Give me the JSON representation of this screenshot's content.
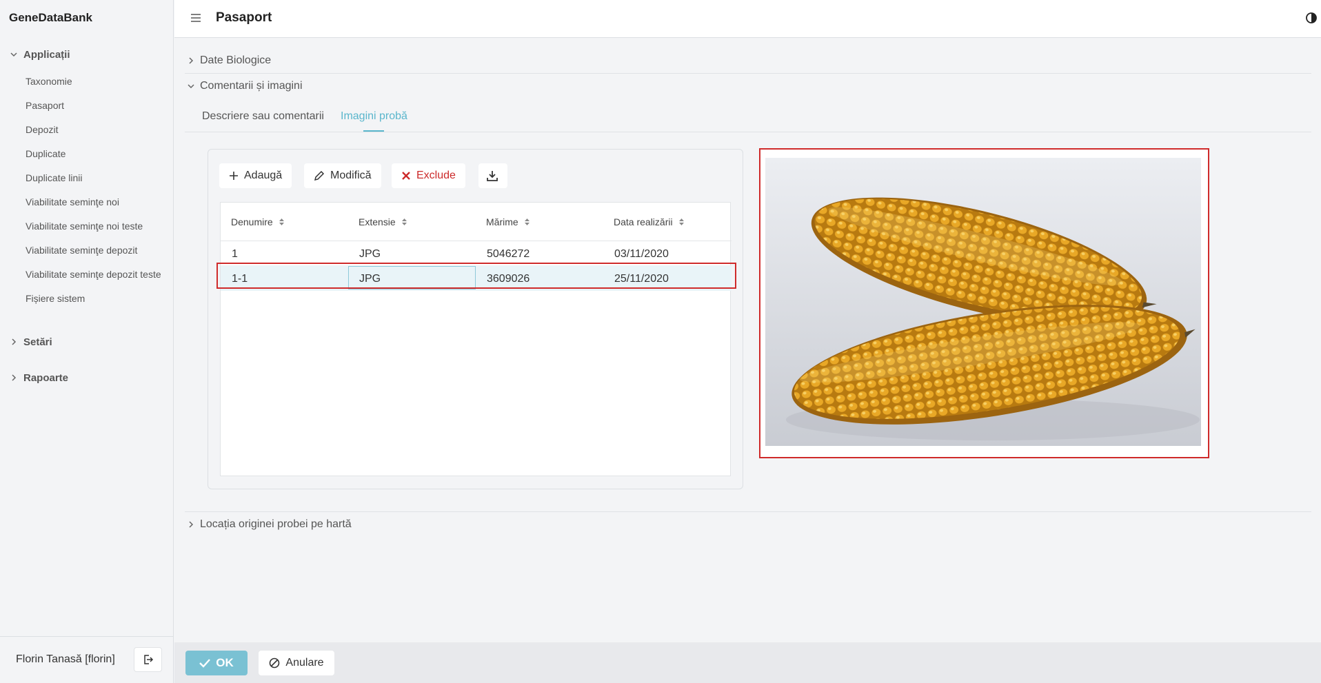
{
  "app": {
    "brand": "GeneDataBank",
    "page_title": "Pasaport"
  },
  "sidebar": {
    "groups": [
      {
        "label": "Applicații",
        "expanded": true
      },
      {
        "label": "Setări",
        "expanded": false
      },
      {
        "label": "Rapoarte",
        "expanded": false
      }
    ],
    "items": [
      "Taxonomie",
      "Pasaport",
      "Depozit",
      "Duplicate",
      "Duplicate linii",
      "Viabilitate seminţe noi",
      "Viabilitate seminţe noi teste",
      "Viabilitate seminţe depozit",
      "Viabilitate seminţe depozit teste",
      "Fișiere sistem"
    ],
    "user": "Florin Tanasă [florin]"
  },
  "sections": {
    "biological": "Date Biologice",
    "comments_images": "Comentarii și imagini",
    "origin_map": "Locația originei probei pe hartă"
  },
  "tabs": [
    {
      "label": "Descriere sau comentarii",
      "active": false
    },
    {
      "label": "Imagini probă",
      "active": true
    }
  ],
  "toolbar": {
    "add": "Adaugă",
    "edit": "Modifică",
    "delete": "Exclude"
  },
  "table": {
    "columns": [
      "Denumire",
      "Extensie",
      "Mărime",
      "Data realizării"
    ],
    "rows": [
      [
        "1",
        "JPG",
        "5046272",
        "03/11/2020"
      ],
      [
        "1-1",
        "JPG",
        "3609026",
        "25/11/2020"
      ]
    ],
    "selected_row": 1
  },
  "footer": {
    "ok": "OK",
    "cancel": "Anulare"
  },
  "colors": {
    "accent": "#5ab6cc",
    "ok_button": "#7ac1d3",
    "danger": "#cc2a2a",
    "highlight": "#cf2a2a"
  }
}
